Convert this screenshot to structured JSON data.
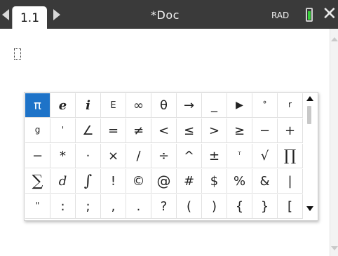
{
  "header": {
    "tab_label": "1.1",
    "doc_title": "*Doc",
    "angle_mode": "RAD",
    "icons": {
      "prev": "caret-left-icon",
      "next": "caret-right-icon",
      "battery": "battery-icon",
      "close": "close-icon"
    },
    "colors": {
      "bar": "#3a3a3a",
      "battery": "#37d13a"
    }
  },
  "palette": {
    "selected": "π",
    "selected_color": "#1e73c8",
    "symbols": [
      "π",
      "e",
      "i",
      "E",
      "∞",
      "θ",
      "→",
      "_",
      "▶",
      "°",
      "r",
      "g",
      "'",
      "∠",
      "=",
      "≠",
      "<",
      "≤",
      ">",
      "≥",
      "−",
      "+",
      "−",
      "*",
      "·",
      "×",
      "/",
      "÷",
      "^",
      "±",
      "ᵀ",
      "√",
      "∏",
      "∑",
      "d",
      "∫",
      "!",
      "©",
      "@",
      "#",
      "$",
      "%",
      "&",
      "|",
      "\"",
      ":",
      ";",
      ",",
      ".",
      "?",
      "(",
      ")",
      "{",
      "}",
      "["
    ]
  }
}
